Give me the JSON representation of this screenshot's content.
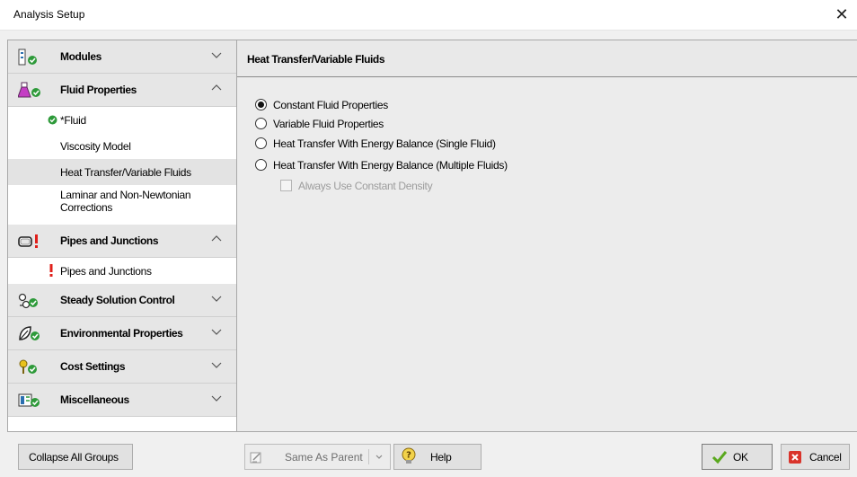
{
  "window": {
    "title": "Analysis Setup"
  },
  "sidebar": {
    "groups": [
      {
        "label": "Modules",
        "icon": "modules-icon",
        "expanded": false,
        "subitems": []
      },
      {
        "label": "Fluid Properties",
        "icon": "fluid-flask-icon",
        "expanded": true,
        "subitems": [
          {
            "label": "*Fluid",
            "status": "check"
          },
          {
            "label": "Viscosity Model"
          },
          {
            "label": "Heat Transfer/Variable Fluids",
            "selected": true
          },
          {
            "label": "Laminar and Non-Newtonian Corrections"
          }
        ]
      },
      {
        "label": "Pipes and Junctions",
        "icon": "pipe-icon",
        "expanded": true,
        "status": "error",
        "subitems": [
          {
            "label": "Pipes and Junctions",
            "status": "error"
          }
        ]
      },
      {
        "label": "Steady Solution Control",
        "icon": "solution-control-icon",
        "expanded": false
      },
      {
        "label": "Environmental Properties",
        "icon": "environment-leaf-icon",
        "expanded": false
      },
      {
        "label": "Cost Settings",
        "icon": "cost-icon",
        "expanded": false
      },
      {
        "label": "Miscellaneous",
        "icon": "miscellaneous-icon",
        "expanded": false
      }
    ]
  },
  "panel": {
    "title": "Heat Transfer/Variable Fluids",
    "options": [
      {
        "label": "Constant Fluid Properties",
        "checked": true
      },
      {
        "label": "Variable Fluid Properties",
        "checked": false
      },
      {
        "label": "Heat Transfer With Energy Balance (Single Fluid)",
        "checked": false
      },
      {
        "label": "Heat Transfer With Energy Balance (Multiple Fluids)",
        "checked": false
      }
    ],
    "checkbox": {
      "label": "Always Use Constant Density",
      "checked": false,
      "enabled": false
    }
  },
  "footer": {
    "collapse_label": "Collapse All Groups",
    "same_as_parent_label": "Same As Parent",
    "help_label": "Help",
    "ok_label": "OK",
    "cancel_label": "Cancel"
  },
  "colors": {
    "check_green": "#2e9a3a",
    "error_red": "#e0201b",
    "cancel_red": "#d9342b"
  }
}
